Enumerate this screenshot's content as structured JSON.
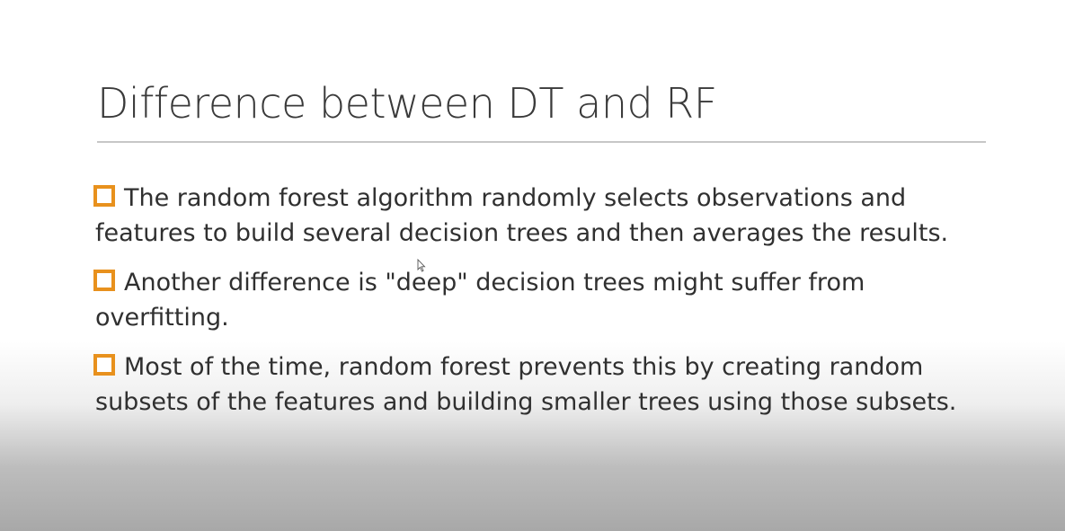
{
  "slide": {
    "title": "Difference between DT and RF",
    "bullets": [
      {
        "lines": [
          "The random forest algorithm randomly selects observations and",
          "features to build several decision trees and then averages the results."
        ]
      },
      {
        "lines": [
          "Another difference is \"deep\" decision trees might suffer from",
          "overfitting."
        ]
      },
      {
        "lines": [
          "Most of the time, random forest prevents this by creating random",
          "subsets of the features and building smaller trees using those subsets."
        ]
      }
    ]
  },
  "colors": {
    "bullet_accent": "#e8911d",
    "title_text": "#3a3a3a",
    "body_text": "#303030",
    "rule": "#c7c7c7"
  },
  "icons": {
    "bullet": "hollow-square-checkbox-icon",
    "pointer": "mouse-cursor-icon"
  }
}
